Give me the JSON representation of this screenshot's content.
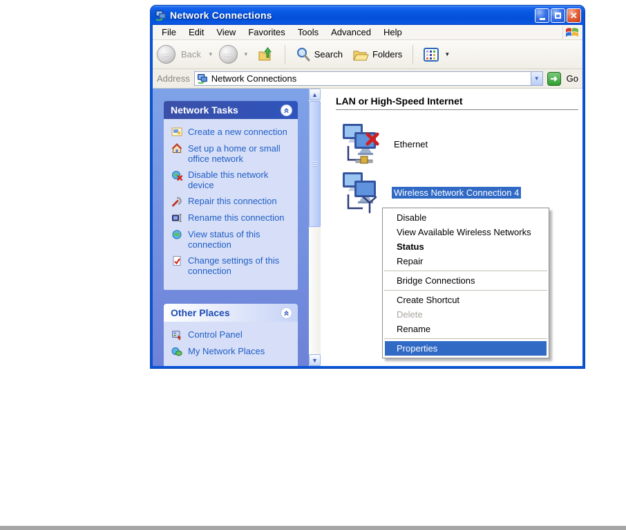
{
  "window": {
    "title": "Network Connections"
  },
  "menubar": {
    "items": [
      "File",
      "Edit",
      "View",
      "Favorites",
      "Tools",
      "Advanced",
      "Help"
    ]
  },
  "toolbar": {
    "back_label": "Back",
    "search_label": "Search",
    "folders_label": "Folders"
  },
  "addressbar": {
    "label": "Address",
    "value": "Network Connections",
    "go_label": "Go"
  },
  "sidebar": {
    "network_tasks": {
      "title": "Network Tasks",
      "items": [
        {
          "label": "Create a new connection",
          "icon": "new-connection-icon"
        },
        {
          "label": "Set up a home or small office network",
          "icon": "home-network-icon"
        },
        {
          "label": "Disable this network device",
          "icon": "disable-device-icon"
        },
        {
          "label": "Repair this connection",
          "icon": "repair-icon"
        },
        {
          "label": "Rename this connection",
          "icon": "rename-icon"
        },
        {
          "label": "View status of this connection",
          "icon": "view-status-icon"
        },
        {
          "label": "Change settings of this connection",
          "icon": "change-settings-icon"
        }
      ]
    },
    "other_places": {
      "title": "Other Places",
      "items": [
        {
          "label": "Control Panel",
          "icon": "control-panel-icon"
        },
        {
          "label": "My Network Places",
          "icon": "network-places-icon"
        }
      ]
    }
  },
  "content": {
    "group_title": "LAN or High-Speed Internet",
    "connections": [
      {
        "label": "Ethernet",
        "selected": false,
        "icon": "ethernet-connection-icon"
      },
      {
        "label": "Wireless Network Connection 4",
        "selected": true,
        "icon": "wireless-connection-icon"
      }
    ]
  },
  "context_menu": {
    "items": [
      {
        "label": "Disable"
      },
      {
        "label": "View Available Wireless Networks"
      },
      {
        "label": "Status",
        "bold": true
      },
      {
        "label": "Repair"
      },
      {
        "type": "separator"
      },
      {
        "label": "Bridge Connections"
      },
      {
        "type": "separator"
      },
      {
        "label": "Create Shortcut"
      },
      {
        "label": "Delete",
        "disabled": true
      },
      {
        "label": "Rename"
      },
      {
        "type": "separator"
      },
      {
        "label": "Properties",
        "highlighted": true
      }
    ]
  },
  "colors": {
    "titlebar_blue": "#0757e2",
    "selection_blue": "#316ac5",
    "link_blue": "#215dc6",
    "task_header_blue": "#3b50a7",
    "panel_body": "#d6dff7",
    "go_green": "#2f9e2f",
    "close_red": "#c63a17"
  }
}
